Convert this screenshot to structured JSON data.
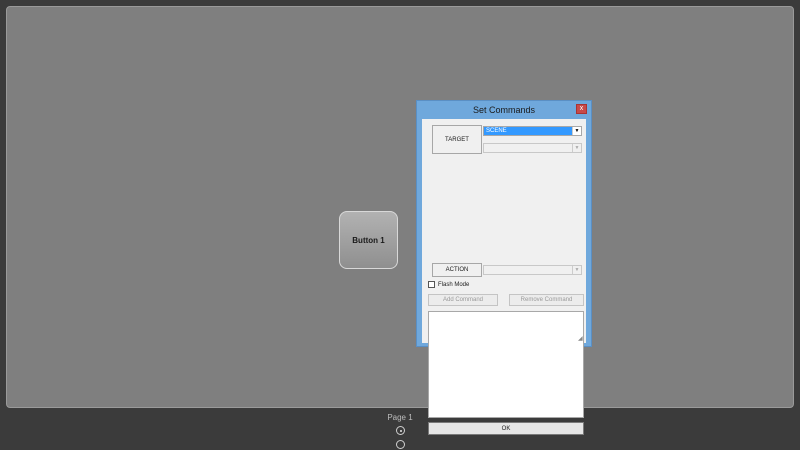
{
  "canvas": {
    "button1_label": "Button 1"
  },
  "dialog": {
    "title": "Set Commands",
    "close_glyph": "x",
    "target_label": "TARGET",
    "target_value": "SCENE",
    "target_sub_value": "",
    "action_label": "ACTION",
    "action_value": "",
    "flash_mode_label": "Flash Mode",
    "flash_mode_checked": false,
    "add_command_label": "Add Command",
    "remove_command_label": "Remove Command",
    "ok_label": "OK",
    "commands": []
  },
  "pager": {
    "label": "Page 1"
  },
  "colors": {
    "dialog_frame": "#6fa8dc",
    "selection": "#3399ff",
    "close_button": "#c74a4a"
  }
}
